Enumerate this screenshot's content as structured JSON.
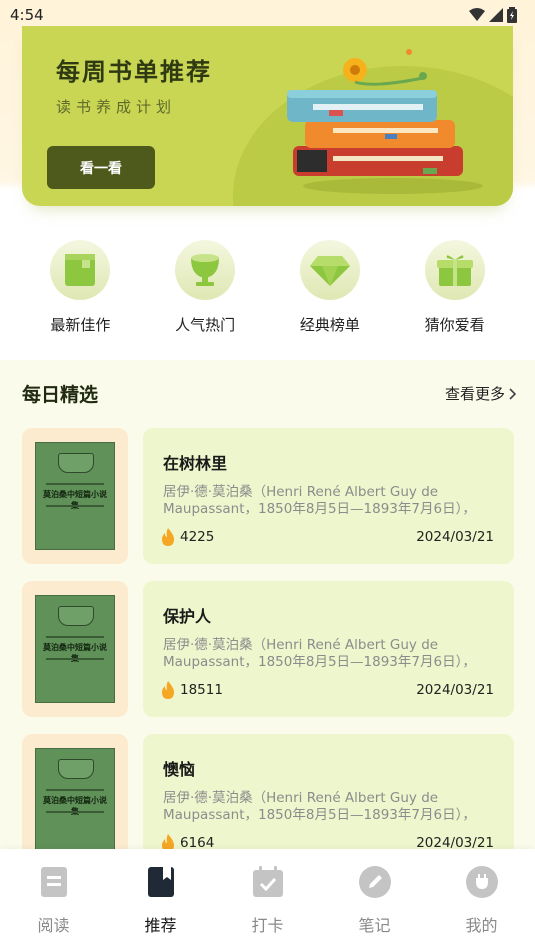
{
  "status_bar": {
    "time": "4:54"
  },
  "banner": {
    "title": "每周书单推荐",
    "subtitle": "读书养成计划",
    "button_label": "看一看"
  },
  "categories": [
    {
      "label": "最新佳作",
      "icon": "book-box-icon"
    },
    {
      "label": "人气热门",
      "icon": "trophy-icon"
    },
    {
      "label": "经典榜单",
      "icon": "diamond-icon"
    },
    {
      "label": "猜你爱看",
      "icon": "gift-icon"
    }
  ],
  "section": {
    "title": "每日精选",
    "more_label": "查看更多"
  },
  "books": [
    {
      "title": "在树林里",
      "description": "居伊·德·莫泊桑（Henri René Albert Guy de Maupassant，1850年8月5日—1893年7月6日），1...",
      "hot": "4225",
      "date": "2024/03/21",
      "cover_title": "莫泊桑中短篇小说集"
    },
    {
      "title": "保护人",
      "description": "居伊·德·莫泊桑（Henri René Albert Guy de Maupassant，1850年8月5日—1893年7月6日），1...",
      "hot": "18511",
      "date": "2024/03/21",
      "cover_title": "莫泊桑中短篇小说集"
    },
    {
      "title": "懊恼",
      "description": "居伊·德·莫泊桑（Henri René Albert Guy de Maupassant，1850年8月5日—1893年7月6日），1...",
      "hot": "6164",
      "date": "2024/03/21",
      "cover_title": "莫泊桑中短篇小说集"
    }
  ],
  "tabs": [
    {
      "label": "阅读",
      "icon": "document-icon",
      "active": false
    },
    {
      "label": "推荐",
      "icon": "bookmark-icon",
      "active": true
    },
    {
      "label": "打卡",
      "icon": "calendar-check-icon",
      "active": false
    },
    {
      "label": "笔记",
      "icon": "pencil-icon",
      "active": false
    },
    {
      "label": "我的",
      "icon": "profile-icon",
      "active": false
    }
  ],
  "colors": {
    "accent": "#c9d653",
    "button_dark": "#4e5a1c",
    "card_bg": "#eef6cd",
    "flame": "#f5a623"
  }
}
